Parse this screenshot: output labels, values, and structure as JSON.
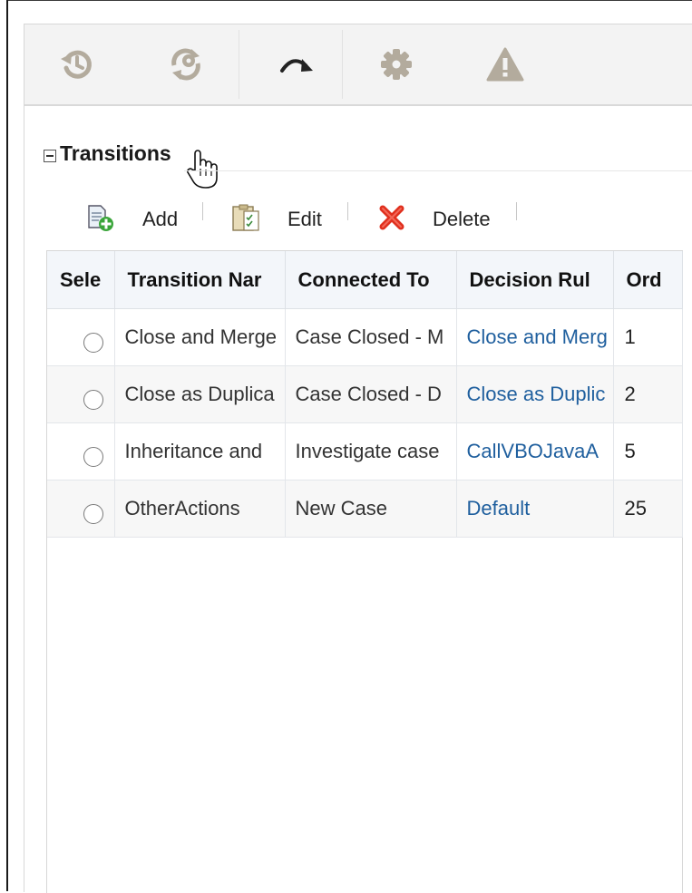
{
  "toolbar": {
    "icons": [
      "history-icon",
      "refresh-gear-icon",
      "redo-arrow-icon",
      "gear-icon",
      "warning-icon"
    ]
  },
  "section": {
    "title": "Transitions"
  },
  "actions": {
    "add_label": "Add",
    "edit_label": "Edit",
    "delete_label": "Delete"
  },
  "grid": {
    "columns": [
      "Sele",
      "Transition Nar",
      "Connected To",
      "Decision Rul",
      "Ord"
    ],
    "rows": [
      {
        "transition_name": "Close and Merge",
        "connected_to": "Case Closed - M",
        "decision_rule": "Close and Merg",
        "order": "1"
      },
      {
        "transition_name": "Close as Duplica",
        "connected_to": "Case Closed - D",
        "decision_rule": "Close as Duplic",
        "order": "2"
      },
      {
        "transition_name": "Inheritance and",
        "connected_to": "Investigate case",
        "decision_rule": "CallVBOJavaA",
        "order": "5"
      },
      {
        "transition_name": "OtherActions",
        "connected_to": "New Case",
        "decision_rule": "Default",
        "order": "25"
      }
    ]
  },
  "colors": {
    "toolbar_bg": "#f3f3f3",
    "toolbar_icon": "#b3ab9d",
    "link": "#1f5f9e",
    "delete_red": "#e0301e",
    "header_bg": "#f3f6fa"
  }
}
